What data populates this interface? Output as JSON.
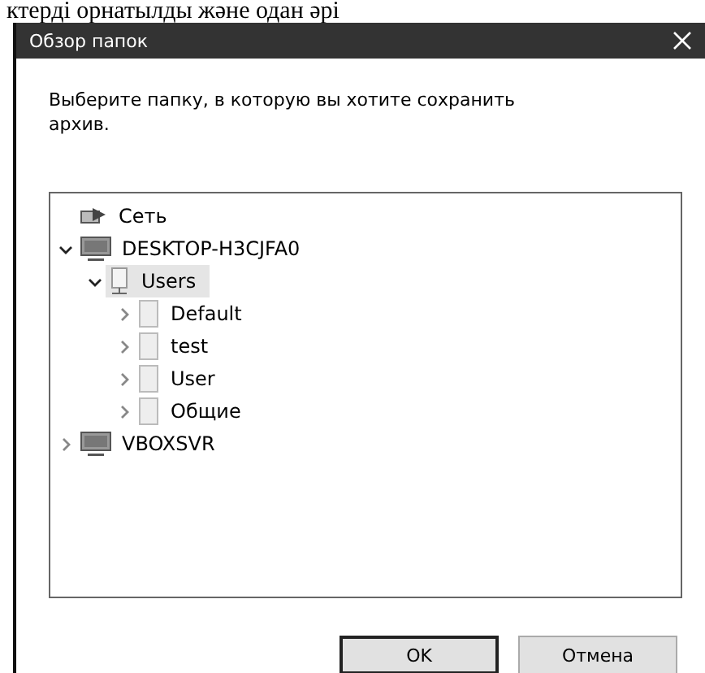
{
  "background_text": "ктерді орнатылды және одан әрі",
  "window": {
    "title": "Обзор папок"
  },
  "instruction": "Выберите папку, в которую вы хотите сохранить архив.",
  "tree": [
    {
      "label": "Сеть",
      "kind": "network",
      "selected": false
    },
    {
      "label": "DESKTOP-H3CJFA0",
      "kind": "computer",
      "selected": false,
      "expanded": true,
      "children": [
        {
          "label": "Users",
          "kind": "share",
          "selected": true,
          "expanded": true,
          "children": [
            {
              "label": "Default",
              "kind": "folder",
              "selected": false,
              "expanded": false
            },
            {
              "label": "test",
              "kind": "folder",
              "selected": false,
              "expanded": false
            },
            {
              "label": "User",
              "kind": "folder",
              "selected": false,
              "expanded": false
            },
            {
              "label": "Общие",
              "kind": "folder",
              "selected": false,
              "expanded": false
            }
          ]
        }
      ]
    },
    {
      "label": "VBOXSVR",
      "kind": "computer",
      "selected": false,
      "expanded": false
    }
  ],
  "buttons": [
    {
      "label": "OK",
      "default": true
    },
    {
      "label": "Отмена",
      "default": false
    }
  ]
}
